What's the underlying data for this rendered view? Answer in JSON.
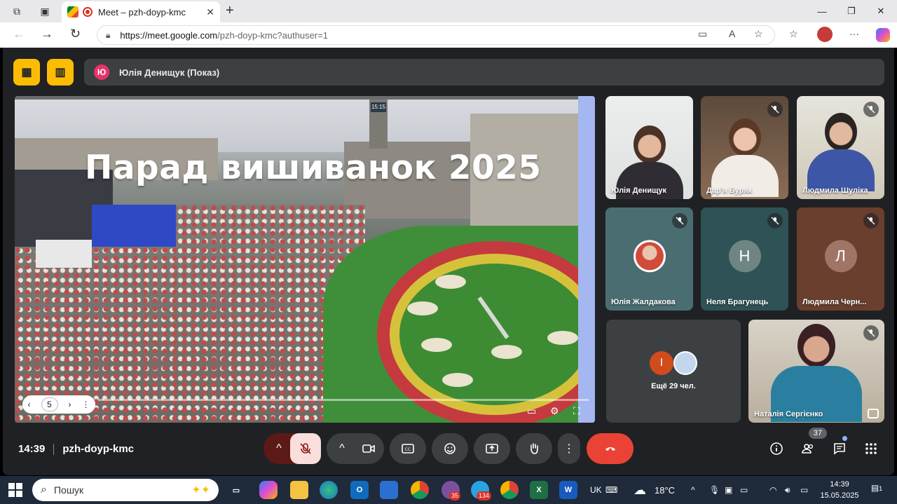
{
  "browser": {
    "tab_title": "Meet – pzh-doyp-kmc",
    "url_host": "https://meet.google.com",
    "url_path": "/pzh-doyp-kmc?authuser=1"
  },
  "meet": {
    "presenter_initial": "Ю",
    "presenter_label": "Юлія Денищук (Показ)",
    "slide_title": "Парад вишиванок 2025",
    "slide_clock": "15:15",
    "page_number": "5",
    "participants": [
      {
        "name": "Юлія Денищук",
        "muted": false
      },
      {
        "name": "Дар'я Буряк",
        "muted": true
      },
      {
        "name": "Людмила Шуліка",
        "muted": true
      },
      {
        "name": "Юлія Жалдакова",
        "muted": true
      },
      {
        "name": "Неля Брагунець",
        "initial": "Н",
        "muted": true
      },
      {
        "name": "Людмила Черн...",
        "initial": "Л",
        "muted": true
      },
      {
        "name": "Наталія Сергієнко",
        "muted": true
      }
    ],
    "more_initial": "І",
    "more_label": "Ещё 29 чел.",
    "time": "14:39",
    "meeting_code": "pzh-doyp-kmc",
    "people_count": "37"
  },
  "taskbar": {
    "search_placeholder": "Пошук",
    "lang": "UK",
    "weather": "18°C",
    "clock_time": "14:39",
    "clock_date": "15.05.2025",
    "badge_viber": "35",
    "badge_telegram": "134",
    "notif_count": "1"
  },
  "colors": {
    "meet_bg": "#202124",
    "accent_yellow": "#fbbc04",
    "end_call": "#ea4335",
    "mic_off": "#f9dedc"
  },
  "icons": [
    "tab-actions-icon",
    "tab-groups-icon",
    "meet-favicon",
    "recording-icon",
    "close-icon",
    "new-tab-icon",
    "back-icon",
    "forward-icon",
    "reload-icon",
    "lock-icon",
    "camera-icon",
    "read-aloud-icon",
    "favorite-icon",
    "collections-icon",
    "profile-icon",
    "more-icon",
    "copilot-icon",
    "presentation-off-icon",
    "layout-icon",
    "mic-off-icon",
    "settings-icon",
    "fullscreen-icon",
    "captions-icon",
    "emoji-icon",
    "present-icon",
    "raise-hand-icon",
    "end-call-icon",
    "info-icon",
    "people-icon",
    "chat-icon",
    "activities-icon"
  ]
}
